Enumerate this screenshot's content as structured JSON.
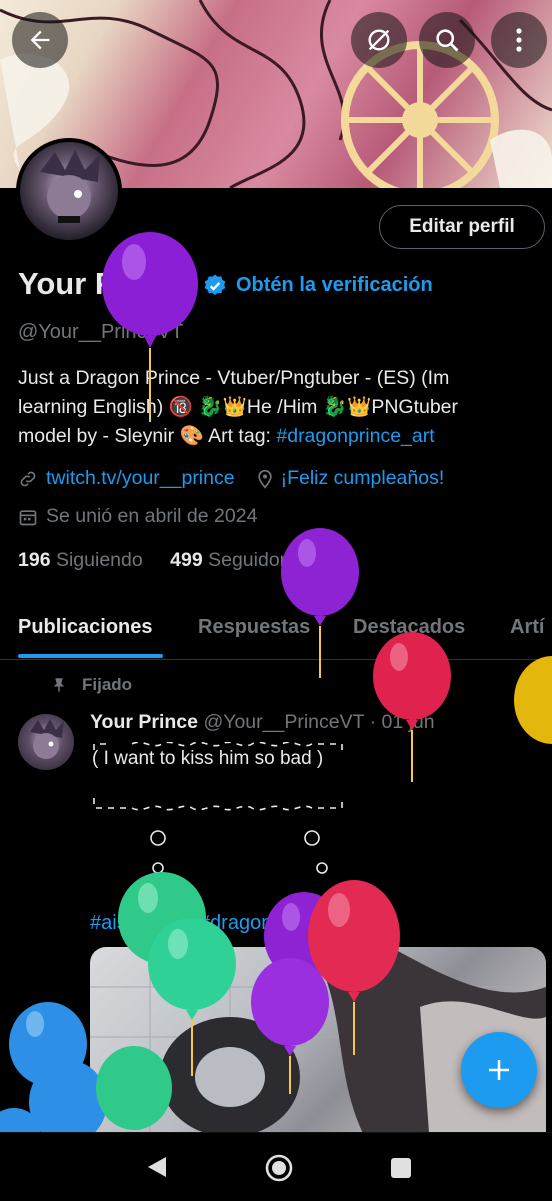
{
  "banner": {
    "description": ""
  },
  "topbar": {
    "back_icon": "arrow-left-icon",
    "hide_icon": "eye-off-icon",
    "search_icon": "search-icon",
    "more_icon": "more-vertical-icon"
  },
  "profile": {
    "name": "Your Prince",
    "verify_text": "Obtén la verificación",
    "handle": "@Your__PrinceVT",
    "edit_label": "Editar perfil",
    "bio_line1": "Just a Dragon Prince - Vtuber/Pngtuber - (ES)  (Im",
    "bio_line2": "learning English) 🔞 🐉👑He /Him 🐉👑PNGtuber",
    "bio_line3_prefix": "model by - Sleynir  🎨 Art tag: ",
    "bio_tag": "#dragonprince_art",
    "link": "twitch.tv/your__prince",
    "birthday": "¡Feliz cumpleaños!",
    "joined": "Se unió en abril de 2024",
    "following_count": "196",
    "following_label": "Siguiendo",
    "followers_count": "499",
    "followers_label": "Seguidores"
  },
  "tabs": [
    "Publicaciones",
    "Respuestas",
    "Destacados",
    "Artí"
  ],
  "pinned_tweet": {
    "pinned_label": "Fijado",
    "author": "Your Prince",
    "handle_time": "@Your__PrinceVT · 01 jun",
    "thought_text": "( I want to kiss him so bad   )",
    "hashtags": "#aisucream #dragonprince_art"
  },
  "colors": {
    "accent": "#1d9bf0",
    "background": "#000000",
    "muted": "#71767b"
  }
}
